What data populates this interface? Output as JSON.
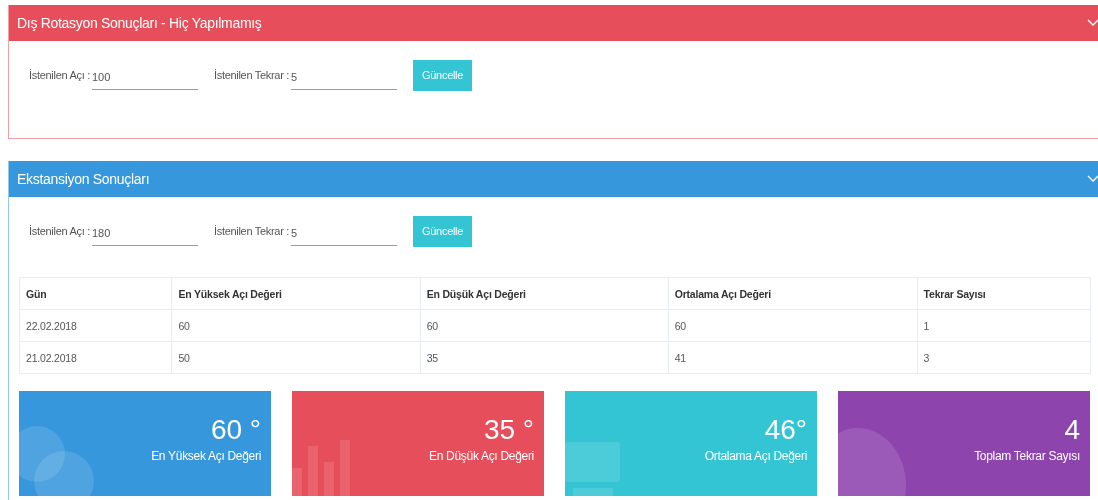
{
  "panels": [
    {
      "title": "Dış Rotasyon Sonuçları - Hiç Yapılmamış",
      "color": "#e64e5b",
      "angle_label": "İstenilen Açı :",
      "angle_value": "100",
      "repeat_label": "İstenilen Tekrar :",
      "repeat_value": "5",
      "button": "Güncelle"
    },
    {
      "title": "Ekstansiyon Sonuçları",
      "color": "#3697dc",
      "angle_label": "İstenilen Açı :",
      "angle_value": "180",
      "repeat_label": "İstenilen Tekrar :",
      "repeat_value": "5",
      "button": "Güncelle",
      "table": {
        "columns": [
          "Gün",
          "En Yüksek Açı Değeri",
          "En Düşük Açı Değeri",
          "Ortalama Açı Değeri",
          "Tekrar Sayısı"
        ],
        "rows": [
          [
            "22.02.2018",
            "60",
            "60",
            "60",
            "1"
          ],
          [
            "21.02.2018",
            "50",
            "35",
            "41",
            "3"
          ]
        ]
      },
      "stats": [
        {
          "kind": "chat",
          "color": "#3697dc",
          "value": "60 °",
          "label": "En Yüksek Açı Değeri"
        },
        {
          "kind": "bars",
          "color": "#e64e5b",
          "value": "35 °",
          "label": "En Düşük Açı Değeri"
        },
        {
          "kind": "monitor",
          "color": "#33c5d3",
          "value": "46°",
          "label": "Ortalama Açı Değeri"
        },
        {
          "kind": "globe",
          "color": "#8e44ad",
          "value": "4",
          "label": "Toplam Tekrar Sayısı"
        }
      ]
    }
  ]
}
